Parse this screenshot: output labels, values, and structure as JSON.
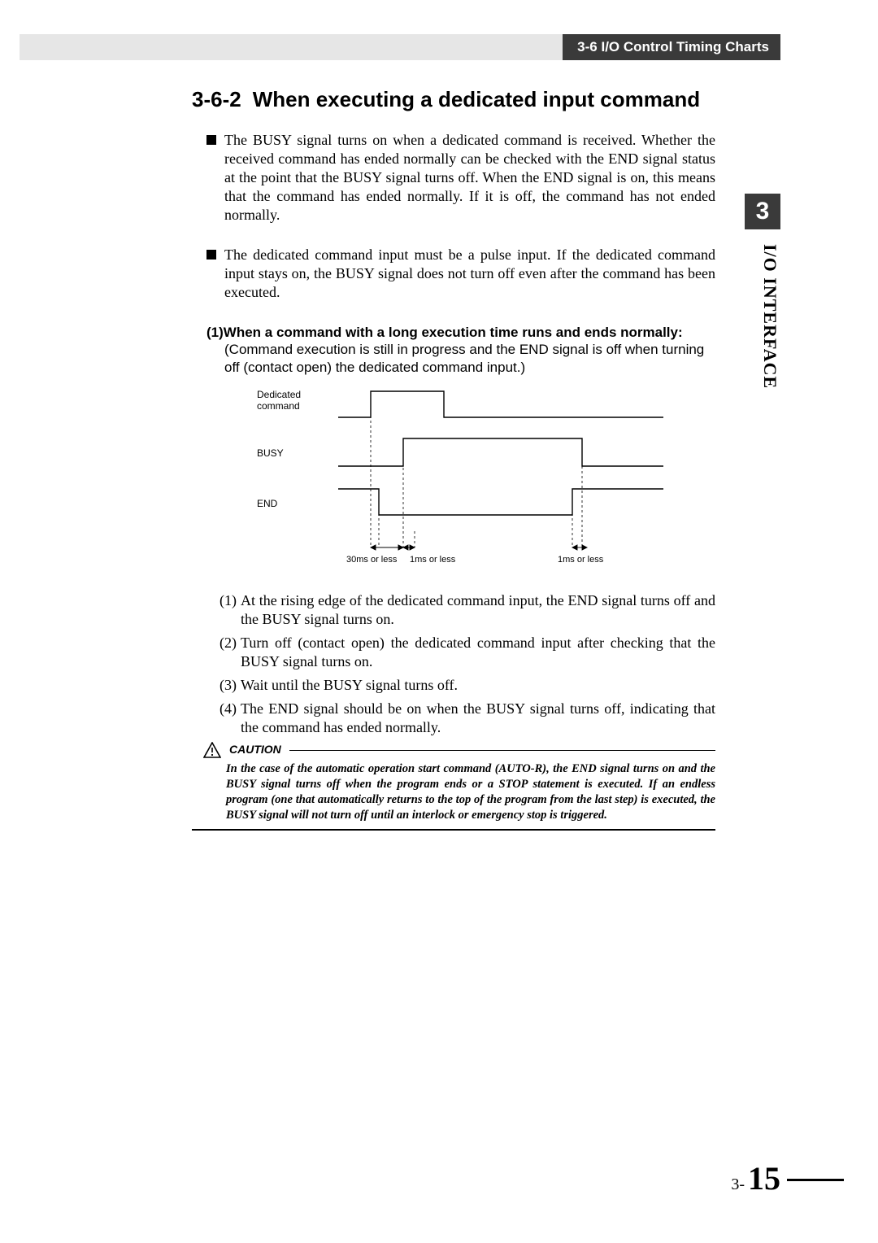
{
  "header": {
    "section": "3-6 I/O Control Timing Charts"
  },
  "chapter": {
    "num": "3",
    "side": "I/O INTERFACE"
  },
  "title": {
    "num": "3-6-2",
    "text": "When executing a dedicated input command"
  },
  "bullet1": "The BUSY signal turns on when a dedicated command is received. Whether the received command has ended normally can be checked with the END signal status at the point that the BUSY signal turns off. When the END signal is on, this means that the command has ended normally. If it is off, the command has not ended normally.",
  "bullet2": "The dedicated command input must be a pulse input. If the dedicated command input stays on, the BUSY signal does not turn off even after the command has been executed.",
  "case1": {
    "heading_num": "(1)",
    "heading": "When a command with a long execution time runs and ends normally:",
    "body": "(Command execution is still in progress and the END signal is off when turning off (contact open) the dedicated command input.)"
  },
  "diagram": {
    "sig1": "Dedicated command",
    "sig2": "BUSY",
    "sig3": "END",
    "t1": "30ms or less",
    "t2": "1ms or less",
    "t3": "1ms or less"
  },
  "steps": [
    "At the rising edge of the dedicated command input, the END signal turns off and the BUSY signal turns on.",
    "Turn off (contact open) the dedicated command input after checking that the BUSY signal turns on.",
    "Wait until the BUSY signal turns off.",
    "The END signal should be on when the BUSY signal turns off, indicating that the command has ended normally."
  ],
  "step_nums": [
    "(1)",
    "(2)",
    "(3)",
    "(4)"
  ],
  "caution": {
    "label": "CAUTION",
    "body": "In the case of the automatic operation start command (AUTO-R), the END signal turns on and the BUSY signal turns off when the program ends or a STOP statement is executed. If an endless program (one that automatically returns to the top of the program from the last step) is executed, the BUSY signal will not turn off until an interlock or emergency stop is triggered."
  },
  "page": {
    "prefix": "3-",
    "num": "15"
  },
  "chart_data": {
    "type": "timing",
    "signals": [
      {
        "name": "Dedicated command",
        "edges": [
          {
            "t": 0,
            "v": 0
          },
          {
            "t": 1,
            "v": 1
          },
          {
            "t": 3,
            "v": 0
          }
        ]
      },
      {
        "name": "BUSY",
        "edges": [
          {
            "t": 0,
            "v": 0
          },
          {
            "t": 2,
            "v": 1
          },
          {
            "t": 7,
            "v": 0
          }
        ]
      },
      {
        "name": "END",
        "edges": [
          {
            "t": 0,
            "v": 1
          },
          {
            "t": 1.2,
            "v": 0
          },
          {
            "t": 6.8,
            "v": 1
          }
        ]
      }
    ],
    "annotations": [
      {
        "label": "30ms or less",
        "from": 1,
        "to": 2
      },
      {
        "label": "1ms or less",
        "from": 2,
        "to": 2.3
      },
      {
        "label": "1ms or less",
        "from": 6.8,
        "to": 7
      }
    ]
  }
}
